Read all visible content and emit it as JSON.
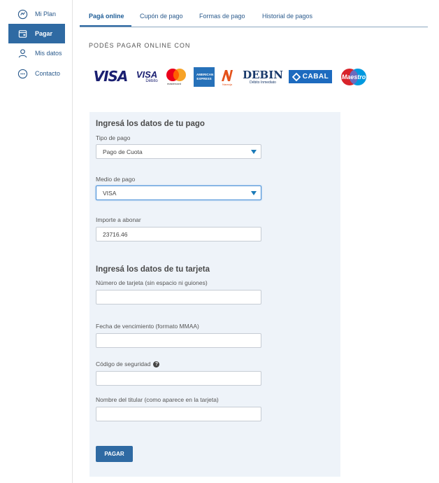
{
  "sidebar": {
    "items": [
      {
        "label": "Mi Plan",
        "icon": "plan-icon"
      },
      {
        "label": "Pagar",
        "icon": "wallet-icon",
        "active": true
      },
      {
        "label": "Mis datos",
        "icon": "user-icon"
      },
      {
        "label": "Contacto",
        "icon": "chat-icon"
      }
    ]
  },
  "tabs": [
    {
      "label": "Pagá online",
      "active": true
    },
    {
      "label": "Cupón de pago"
    },
    {
      "label": "Formas de pago"
    },
    {
      "label": "Historial de pagos"
    }
  ],
  "pay_with_label": "PODÉS PAGAR ONLINE CON",
  "logos": {
    "visa": "VISA",
    "visa_debit": "VISA",
    "visa_debit_sub": "Débito",
    "mastercard": "mastercard",
    "amex": "AMERICAN EXPRESS",
    "naranja": "Naranja",
    "debin": "DEBIN",
    "debin_sub": "Débito Inmediato",
    "cabal": "CABAL",
    "maestro": "Maestro"
  },
  "payment_section": {
    "title": "Ingresá los datos de tu pago",
    "tipo_label": "Tipo de pago",
    "tipo_value": "Pago de Cuota",
    "medio_label": "Medio de pago",
    "medio_value": "VISA",
    "importe_label": "Importe a abonar",
    "importe_value": "23716.46"
  },
  "card_section": {
    "title": "Ingresá los datos de tu tarjeta",
    "numero_label": "Número de tarjeta (sin espacio ni guiones)",
    "vencimiento_label": "Fecha de vencimiento (formato MMAA)",
    "codigo_label": "Código de seguridad",
    "titular_label": "Nombre del titular (como aparece en la tarjeta)"
  },
  "pay_button": "PAGAR",
  "colors": {
    "accent": "#2f6aa3",
    "panel": "#eef3f9"
  }
}
